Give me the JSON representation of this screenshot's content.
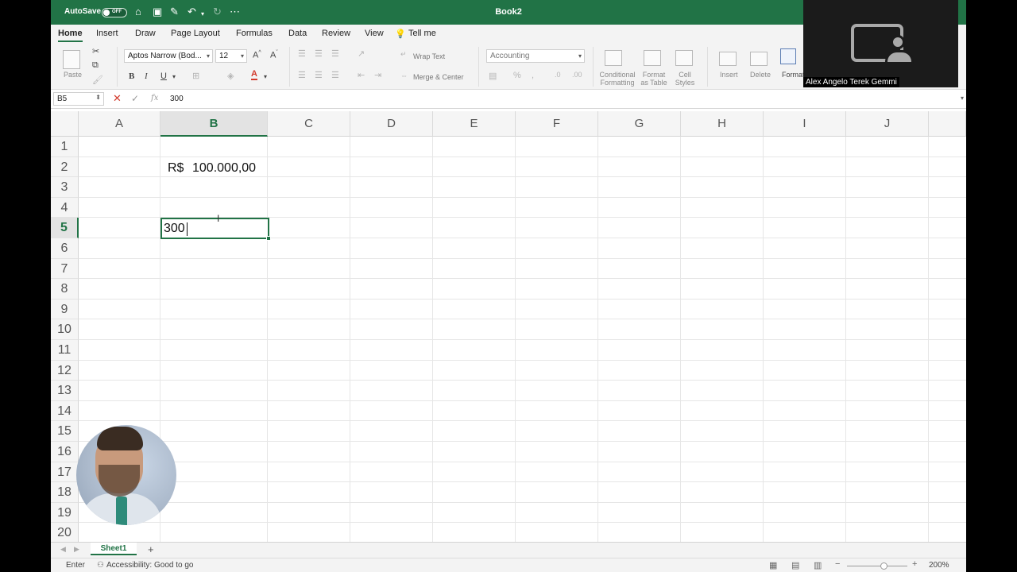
{
  "window": {
    "title": "Book2",
    "autosave_label": "AutoSave",
    "autosave_state": "OFF"
  },
  "ribbon": {
    "tabs": [
      "Home",
      "Insert",
      "Draw",
      "Page Layout",
      "Formulas",
      "Data",
      "Review",
      "View",
      "Tell me"
    ],
    "active_tab": "Home",
    "paste_label": "Paste",
    "font_name": "Aptos Narrow (Bod...",
    "font_size": "12",
    "bold": "B",
    "italic": "I",
    "underline": "U",
    "wrap_text": "Wrap Text",
    "merge_center": "Merge & Center",
    "number_format": "Accounting",
    "conditional_formatting": [
      "Conditional",
      "Formatting"
    ],
    "format_as_table": [
      "Format",
      "as Table"
    ],
    "cell_styles": [
      "Cell",
      "Styles"
    ],
    "insert_label": "Insert",
    "delete_label": "Delete",
    "format_label": "Format"
  },
  "formula_bar": {
    "name_box": "B5",
    "fx": "fx",
    "value": "300"
  },
  "grid": {
    "columns": [
      "A",
      "B",
      "C",
      "D",
      "E",
      "F",
      "G",
      "H",
      "I",
      "J"
    ],
    "selected_column": "B",
    "rows": [
      "1",
      "2",
      "3",
      "4",
      "5",
      "6",
      "7",
      "8",
      "9",
      "10",
      "11",
      "12",
      "13",
      "14",
      "15",
      "16",
      "17",
      "18",
      "19",
      "20"
    ],
    "selected_row": "5",
    "cells": {
      "B2_currency": "R$",
      "B2_amount": "100.000,00",
      "B5_editing": "300"
    }
  },
  "sheets": {
    "tabs": [
      "Sheet1"
    ],
    "add": "+"
  },
  "status": {
    "mode": "Enter",
    "accessibility": "Accessibility: Good to go",
    "zoom": "200%",
    "zoom_fraction": 0.6
  },
  "participant": {
    "name": "Alex Angelo Terek Gemmi"
  },
  "colors": {
    "excel_green": "#217346",
    "cancel_red": "#d23a2c"
  }
}
